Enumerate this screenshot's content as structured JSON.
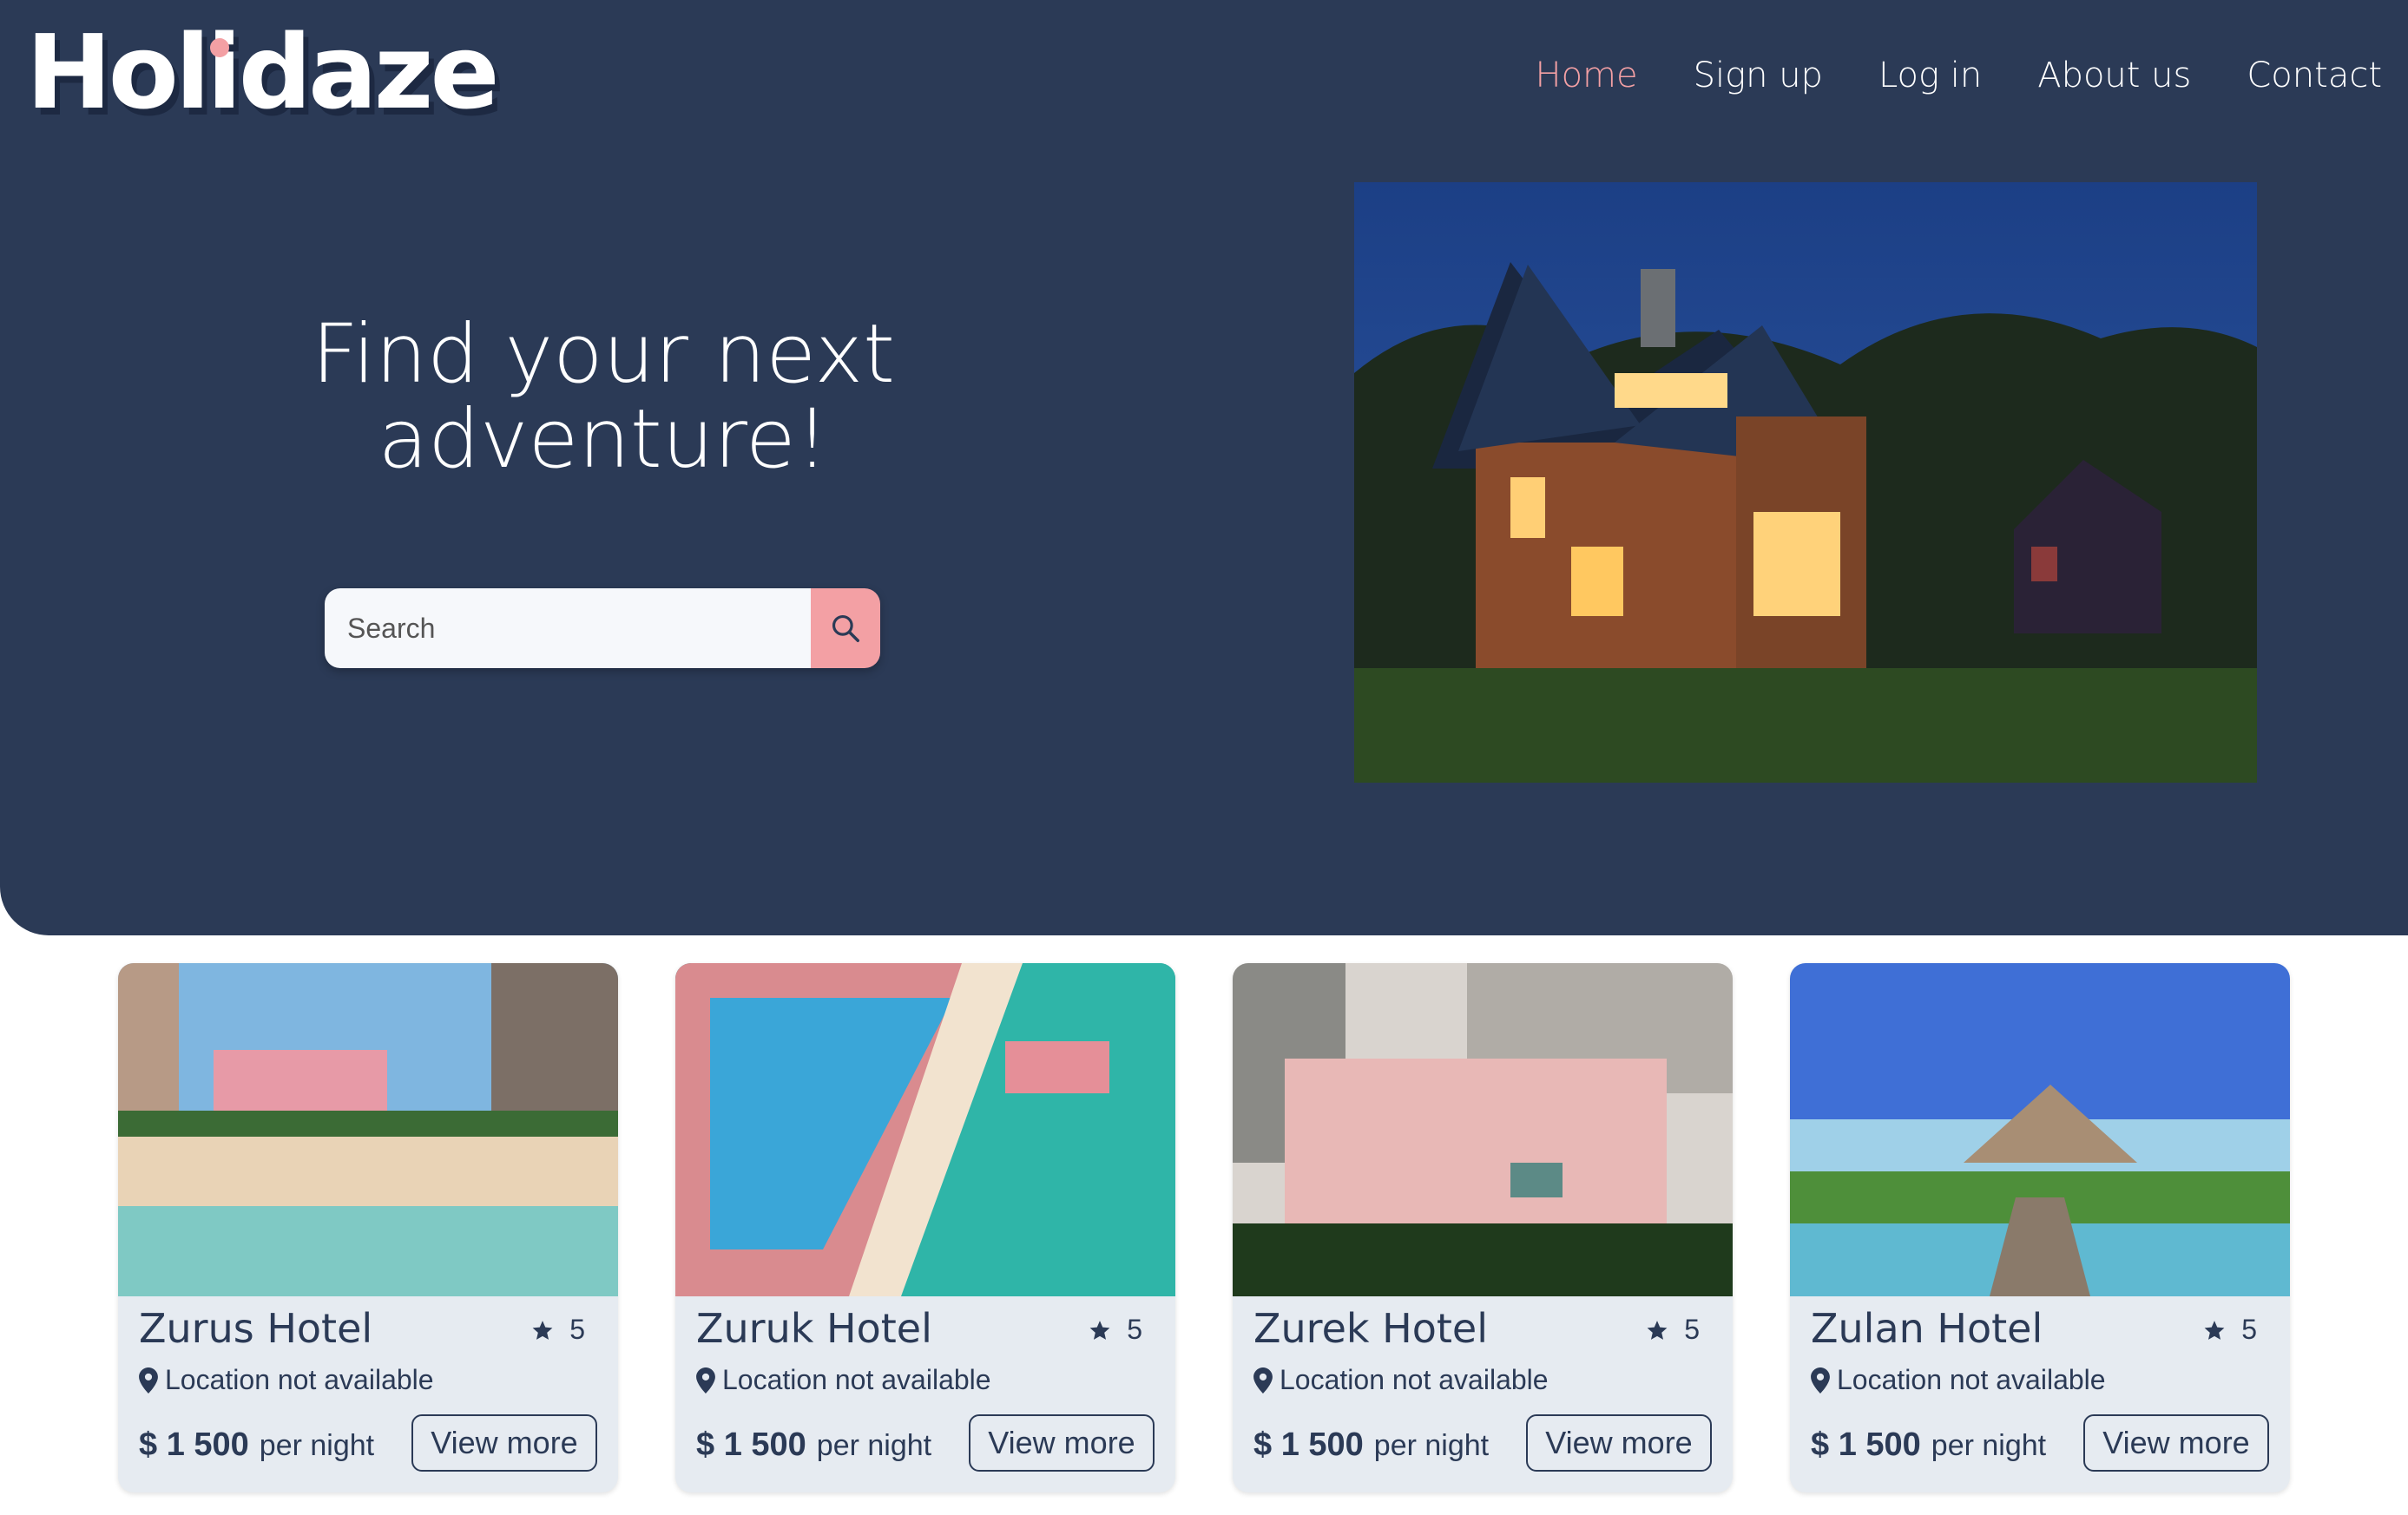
{
  "brand": {
    "logo_text": "Holidaze"
  },
  "nav": {
    "items": [
      {
        "label": "Home",
        "active": true
      },
      {
        "label": "Sign up",
        "active": false
      },
      {
        "label": "Log in",
        "active": false
      },
      {
        "label": "About us",
        "active": false
      },
      {
        "label": "Contact",
        "active": false
      }
    ]
  },
  "hero": {
    "headline_line1": "Find your next",
    "headline_line2": "adventure!",
    "search": {
      "placeholder": "Search",
      "value": ""
    },
    "image_alt": "house"
  },
  "hotels": [
    {
      "name": "Zurus Hotel",
      "rating": "5",
      "location": "Location not available",
      "price": "$ 1 500",
      "price_unit": "per night",
      "button": "View more"
    },
    {
      "name": "Zuruk Hotel",
      "rating": "5",
      "location": "Location not available",
      "price": "$ 1 500",
      "price_unit": "per night",
      "button": "View more"
    },
    {
      "name": "Zurek Hotel",
      "rating": "5",
      "location": "Location not available",
      "price": "$ 1 500",
      "price_unit": "per night",
      "button": "View more"
    },
    {
      "name": "Zulan Hotel",
      "rating": "5",
      "location": "Location not available",
      "price": "$ 1 500",
      "price_unit": "per night",
      "button": "View more"
    }
  ],
  "colors": {
    "navy": "#2b3a56",
    "accent_pink": "#f3a0a4",
    "card_bg": "#e6ebf1"
  }
}
